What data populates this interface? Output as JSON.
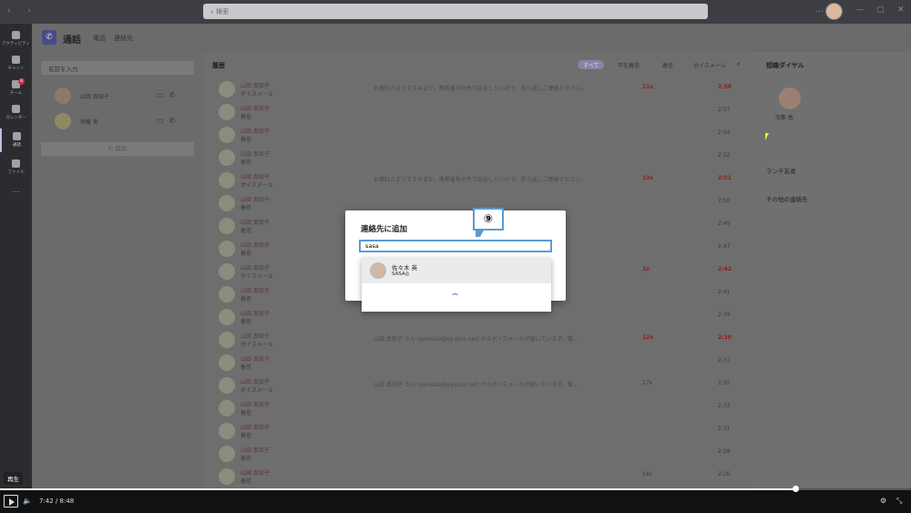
{
  "titlebar": {
    "search_placeholder": "検索"
  },
  "rail": [
    {
      "label": "アクティビティ",
      "icon": "bell-icon"
    },
    {
      "label": "チャット",
      "icon": "chat-icon"
    },
    {
      "label": "チーム",
      "icon": "teams-icon",
      "badge": "8"
    },
    {
      "label": "カレンダー",
      "icon": "calendar-icon"
    },
    {
      "label": "通話",
      "icon": "phone-icon"
    },
    {
      "label": "ファイル",
      "icon": "file-icon"
    },
    {
      "label": "…",
      "icon": "more-icon"
    }
  ],
  "app": {
    "title": "通話",
    "tabs": [
      "電話",
      "連絡先"
    ]
  },
  "left": {
    "search_placeholder": "名前を入力",
    "contacts": [
      {
        "name": "山田 真知子"
      },
      {
        "name": "伊藤 実"
      }
    ],
    "add_label": "追加"
  },
  "history": {
    "title": "履歴",
    "filters": [
      "すべて",
      "不在着信",
      "着信",
      "ボイスメール"
    ],
    "rows": [
      {
        "name": "山田 真知子",
        "sub": "ボイスメール",
        "msg": "お疲れさまですすみませ。携帯番号の件で話をしたいので、折り返しご連絡ください。",
        "dur": "11s",
        "time": "2:58",
        "missed": true
      },
      {
        "name": "山田 真知子",
        "sub": "着信",
        "msg": "",
        "dur": "",
        "time": "2:57",
        "missed": false
      },
      {
        "name": "山田 真知子",
        "sub": "着信",
        "msg": "",
        "dur": "",
        "time": "2:54",
        "missed": false
      },
      {
        "name": "山田 真知子",
        "sub": "着信",
        "msg": "",
        "dur": "",
        "time": "2:52",
        "missed": false
      },
      {
        "name": "山田 真知子",
        "sub": "ボイスメール",
        "msg": "お疲れさまですすみませ。携帯番号の件で話をしたいので、折り返しご連絡ください。",
        "dur": "13s",
        "time": "2:51",
        "missed": true
      },
      {
        "name": "山田 真知子",
        "sub": "着信",
        "msg": "",
        "dur": "",
        "time": "2:50",
        "missed": false
      },
      {
        "name": "山田 真知子",
        "sub": "着信",
        "msg": "",
        "dur": "",
        "time": "2:49",
        "missed": false
      },
      {
        "name": "山田 真知子",
        "sub": "着信",
        "msg": "",
        "dur": "",
        "time": "2:47",
        "missed": false
      },
      {
        "name": "山田 真知子",
        "sub": "ボイスメール",
        "msg": "",
        "dur": "1x",
        "time": "2:42",
        "missed": true
      },
      {
        "name": "山田 真知子",
        "sub": "着信",
        "msg": "",
        "dur": "",
        "time": "2:41",
        "missed": false
      },
      {
        "name": "山田 真知子",
        "sub": "着信",
        "msg": "",
        "dur": "",
        "time": "2:39",
        "missed": false
      },
      {
        "name": "山田 真知子",
        "sub": "ボイスメール",
        "msg": "山田 真知子 さん (yamada@sg-plus.net) からボイスメールが届いています。電...",
        "dur": "12x",
        "time": "2:38",
        "missed": true
      },
      {
        "name": "山田 真知子",
        "sub": "着信",
        "msg": "",
        "dur": "",
        "time": "2:37",
        "missed": false
      },
      {
        "name": "山田 真知子",
        "sub": "ボイスメール",
        "msg": "山田 真知子 さん (yamada@sg-plus.net) からボイスメールが届いています。電...",
        "dur": "17s",
        "time": "2:35",
        "missed": false
      },
      {
        "name": "山田 真知子",
        "sub": "着信",
        "msg": "",
        "dur": "",
        "time": "2:33",
        "missed": false
      },
      {
        "name": "山田 真知子",
        "sub": "着信",
        "msg": "",
        "dur": "",
        "time": "2:31",
        "missed": false
      },
      {
        "name": "山田 真知子",
        "sub": "着信",
        "msg": "",
        "dur": "",
        "time": "2:28",
        "missed": false
      },
      {
        "name": "山田 真知子",
        "sub": "着信",
        "msg": "",
        "dur": "14s",
        "time": "2:26",
        "missed": false
      },
      {
        "name": "山田 真知子",
        "sub": "着信",
        "msg": "",
        "dur": "1m 51s",
        "time": "2:22",
        "missed": false
      }
    ]
  },
  "speed_dial": {
    "title": "短縮ダイヤル",
    "contact_name": "次郎 佐",
    "links": [
      "ランチ友達",
      "その他の連絡先"
    ]
  },
  "dialog": {
    "title": "連絡先に追加",
    "input_value": "sasa",
    "result_name": "佐々木 英",
    "result_sub": "SASA◎",
    "callout_number": "⑨"
  },
  "player": {
    "tooltip": "再生",
    "time": "7:42 / 8:48",
    "progress": 0.873
  }
}
